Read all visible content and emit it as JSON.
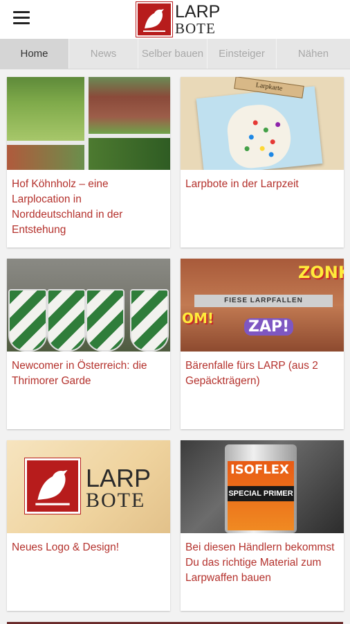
{
  "app": {
    "logo_line1": "LARP",
    "logo_line2": "BOTE",
    "accent_color": "#b4312c",
    "logo_color": "#b71c1c"
  },
  "tabs": [
    {
      "label": "Home",
      "active": true
    },
    {
      "label": "News",
      "active": false
    },
    {
      "label": "Selber bauen",
      "active": false
    },
    {
      "label": "Einsteiger",
      "active": false
    },
    {
      "label": "Nähen",
      "active": false
    }
  ],
  "articles": [
    {
      "title": "Hof Köhnholz – eine Larplocation in Norddeutschland in der Entstehung",
      "image_icon": "farm-collage-image"
    },
    {
      "title": "Larpbote in der Larpzeit",
      "image_icon": "larp-map-image",
      "image_label": "Larpkarte"
    },
    {
      "title": "Newcomer in Österreich: die Thrimorer Garde",
      "image_icon": "shield-guard-image"
    },
    {
      "title": "Bärenfalle fürs LARP (aus 2 Gepäckträgern)",
      "image_icon": "comic-trap-image",
      "image_banner": "FIESE LARPFALLEN",
      "image_words": [
        "ZONK",
        "OM!",
        "ZAP!"
      ]
    },
    {
      "title": "Neues Logo & Design!",
      "image_icon": "logo-image",
      "image_logo_line1": "LARP",
      "image_logo_line2": "BOTE"
    },
    {
      "title": "Bei diesen Händlern bekommst Du das richtige Material zum Larpwaffen bauen",
      "image_icon": "primer-can-image",
      "image_brand": "ISOFLEX",
      "image_product": "SPECIAL PRIMER"
    }
  ]
}
